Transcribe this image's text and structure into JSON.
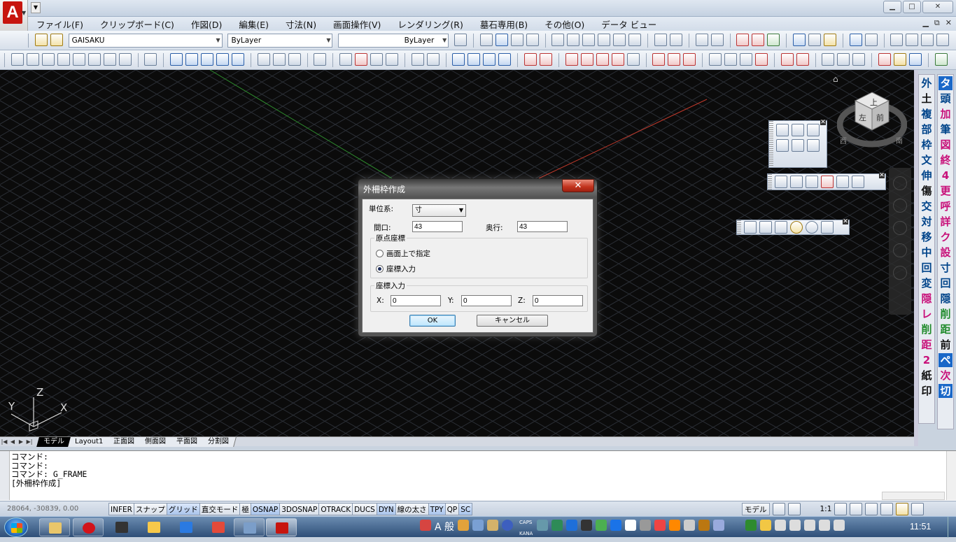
{
  "window": {
    "logo_letter": "A",
    "minimize": "▁",
    "maximize": "□",
    "close": "✕"
  },
  "menu": [
    "ファイル(F)",
    "クリップボード(C)",
    "作図(D)",
    "編集(E)",
    "寸法(N)",
    "画面操作(V)",
    "レンダリング(R)",
    "墓石専用(B)",
    "その他(O)",
    "データ ビュー"
  ],
  "mdi": {
    "minimize": "▁",
    "restore": "⧉",
    "close": "✕"
  },
  "toolbar1": {
    "layer_name": "GAISAKU",
    "color_value": "ByLayer",
    "linetype_value": "ByLayer"
  },
  "colors": {
    "canvas_bg": "#0b0b0b",
    "grid_line": "#2b2f36",
    "axis_x": "#c0392b",
    "axis_y": "#2e8b2e",
    "dialog_title_bg": "#5a5a5a",
    "accent_blue": "#1a68c8",
    "accent_magenta": "#c8117a"
  },
  "viewcube": {
    "top": "上",
    "left": "左",
    "front": "前",
    "west": "西",
    "south": "南"
  },
  "ucs": {
    "x": "X",
    "y": "Y",
    "z": "Z"
  },
  "layout_tabs": [
    "モデル",
    "Layout1",
    "正面図",
    "側面図",
    "平面図",
    "分割図"
  ],
  "active_tab": "モデル",
  "right_panel_1": [
    "外",
    "土",
    "複",
    "部",
    "枠",
    "文",
    "伸",
    "傷",
    "交",
    "対",
    "移",
    "中",
    "回",
    "変",
    "隠",
    "レ",
    "削",
    "距",
    "2",
    "紙",
    "印"
  ],
  "right_panel_2": [
    "タ",
    "頭",
    "加",
    "筆",
    "図",
    "終",
    "4",
    "更",
    "呼",
    "詳",
    "ク",
    "設",
    "寸",
    "回",
    "隠",
    "削",
    "距",
    "前",
    "ペ",
    "次",
    "切"
  ],
  "command_line": {
    "lines": [
      "コマンド:",
      "コマンド:",
      "コマンド: G_FRAME",
      "[外柵枠作成]"
    ]
  },
  "status": {
    "coords": "28064, -30839, 0.00",
    "toggles": [
      {
        "label": "INFER",
        "on": false
      },
      {
        "label": "スナップ",
        "on": false
      },
      {
        "label": "グリッド",
        "on": true
      },
      {
        "label": "直交モード",
        "on": false
      },
      {
        "label": "極",
        "on": false
      },
      {
        "label": "OSNAP",
        "on": true
      },
      {
        "label": "3DOSNAP",
        "on": false
      },
      {
        "label": "OTRACK",
        "on": false
      },
      {
        "label": "DUCS",
        "on": false
      },
      {
        "label": "DYN",
        "on": true
      },
      {
        "label": "線の太さ",
        "on": false
      },
      {
        "label": "TPY",
        "on": true
      },
      {
        "label": "QP",
        "on": false
      },
      {
        "label": "SC",
        "on": true
      }
    ],
    "model_label": "モデル",
    "scale": "1:1"
  },
  "dialog": {
    "title": "外柵枠作成",
    "close": "✕",
    "unit_label": "単位系:",
    "unit_value": "寸",
    "frontage_label": "間口:",
    "frontage_value": "43",
    "depth_label": "奥行:",
    "depth_value": "43",
    "origin_group": "原点座標",
    "radio_screen": "画面上で指定",
    "radio_coord": "座標入力",
    "coord_group": "座標入力",
    "x_label": "X:",
    "x_value": "0",
    "y_label": "Y:",
    "y_value": "0",
    "z_label": "Z:",
    "z_value": "0",
    "ok": "OK",
    "cancel": "キャンセル"
  },
  "taskbar": {
    "ime_mode": "A 般",
    "caps": "CAPS",
    "kana": "KANA",
    "time": "11:51"
  }
}
